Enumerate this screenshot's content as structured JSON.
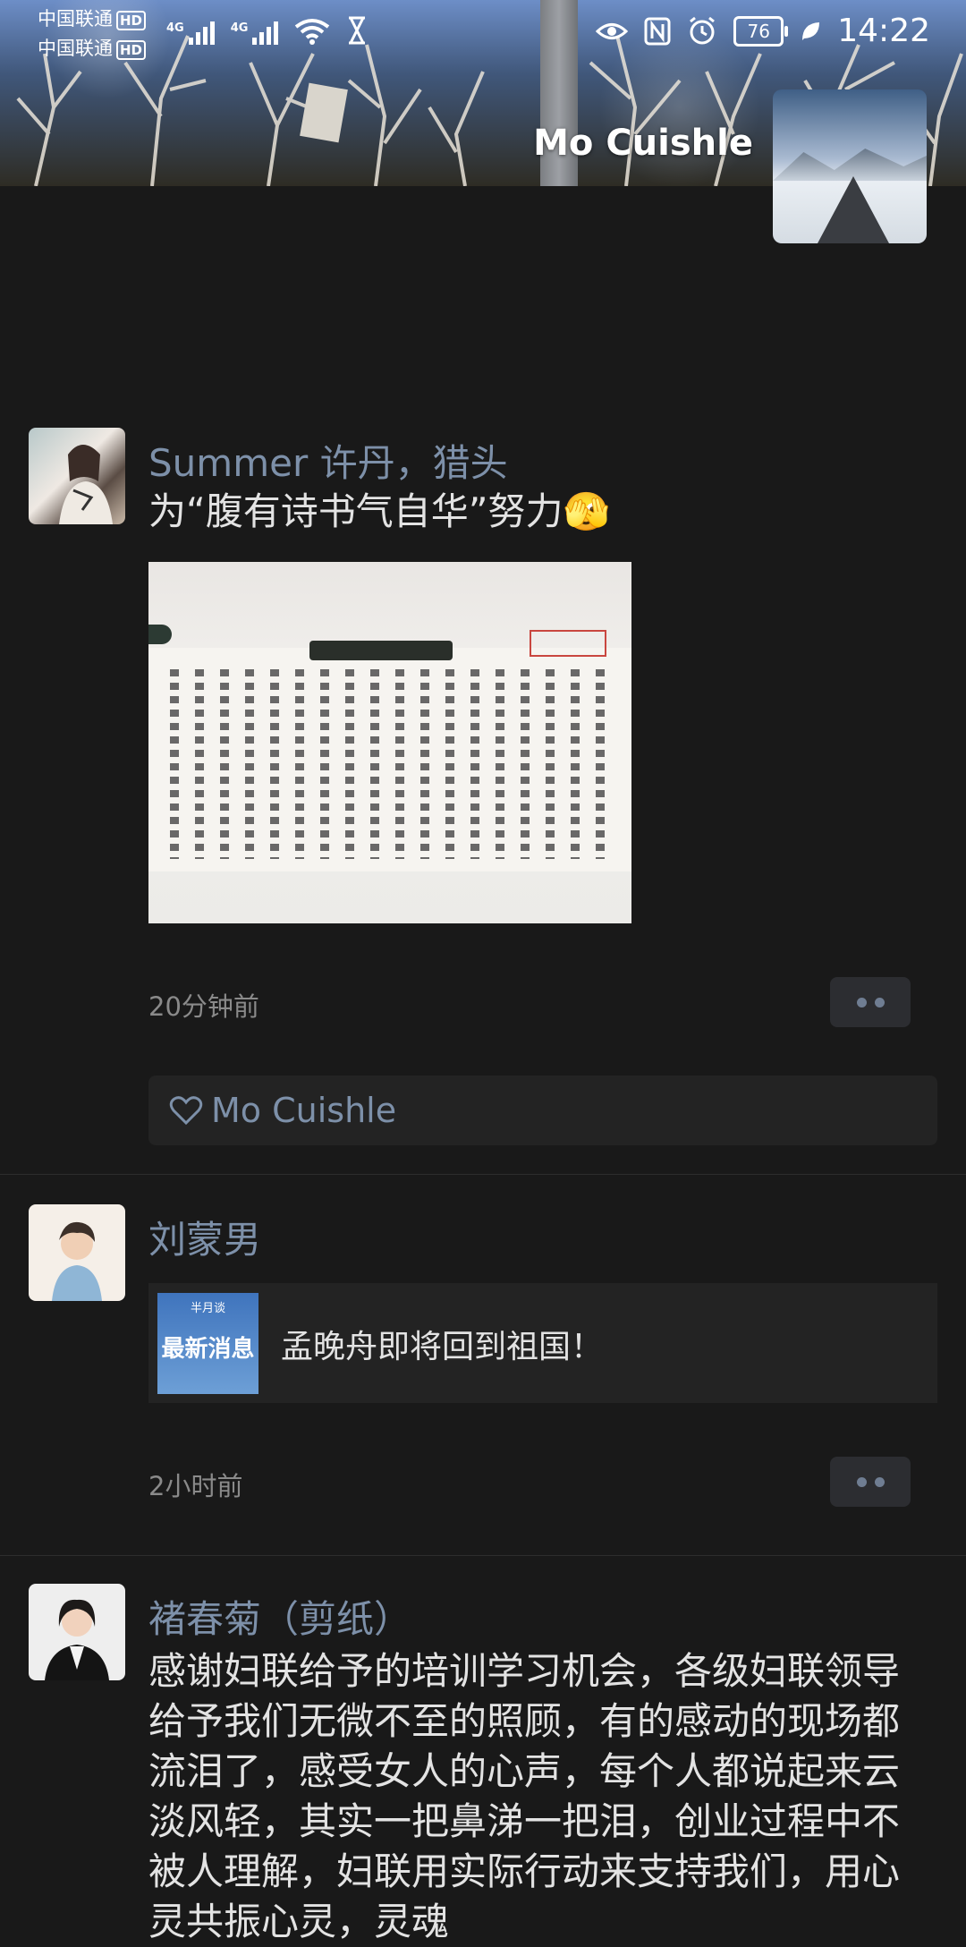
{
  "status_bar": {
    "carrier1": "中国联通",
    "carrier2": "中国联通",
    "hd_badge": "HD",
    "network_label": "4G",
    "battery": "76",
    "time": "14:22"
  },
  "cover": {
    "user_name": "Mo Cuishle"
  },
  "posts": [
    {
      "name": "Summer  许丹，猎头",
      "text": "为“腹有诗书气自华”努力🫣",
      "time": "20分钟前",
      "likes": "Mo Cuishle"
    },
    {
      "name": "刘蒙男",
      "share_brand": "半月谈",
      "share_tag": "最新消息",
      "share_title": "孟晚舟即将回到祖国！",
      "time": "2小时前"
    },
    {
      "name": "褚春菊（剪纸）",
      "text": "感谢妇联给予的培训学习机会，各级妇联领导给予我们无微不至的照顾，有的感动的现场都流泪了，感受女人的心声，每个人都说起来云淡风轻，其实一把鼻涕一把泪，创业过程中不被人理解，妇联用实际行动来支持我们，用心灵共振心灵，灵魂"
    }
  ]
}
